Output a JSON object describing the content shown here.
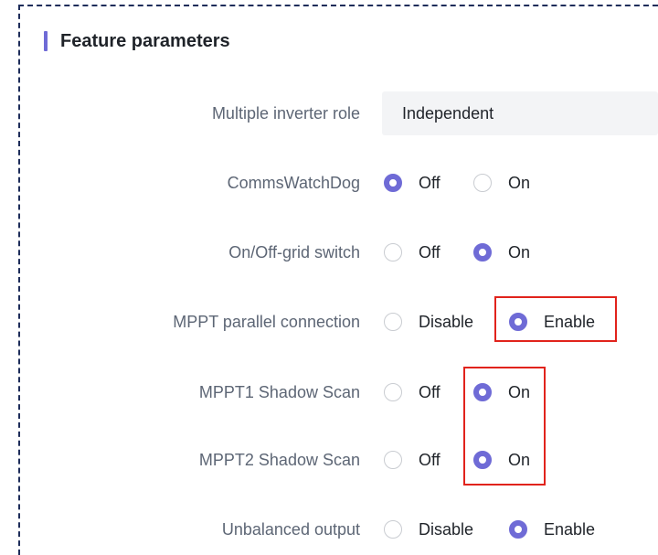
{
  "section": {
    "title": "Feature parameters"
  },
  "multiple_inverter_role": {
    "label": "Multiple inverter role",
    "value": "Independent"
  },
  "comms_watchdog": {
    "label": "CommsWatchDog",
    "options": [
      "Off",
      "On"
    ],
    "selected": "Off"
  },
  "on_off_grid_switch": {
    "label": "On/Off-grid switch",
    "options": [
      "Off",
      "On"
    ],
    "selected": "On"
  },
  "mppt_parallel_connection": {
    "label": "MPPT parallel connection",
    "options": [
      "Disable",
      "Enable"
    ],
    "selected": "Enable"
  },
  "mppt1_shadow_scan": {
    "label": "MPPT1 Shadow Scan",
    "options": [
      "Off",
      "On"
    ],
    "selected": "On"
  },
  "mppt2_shadow_scan": {
    "label": "MPPT2 Shadow Scan",
    "options": [
      "Off",
      "On"
    ],
    "selected": "On"
  },
  "unbalanced_output": {
    "label": "Unbalanced output",
    "options": [
      "Disable",
      "Enable"
    ],
    "selected": "Enable"
  },
  "colors": {
    "accent": "#6f6bd6",
    "highlight_border": "#e1231c",
    "frame_dash": "#1e2d5a"
  }
}
